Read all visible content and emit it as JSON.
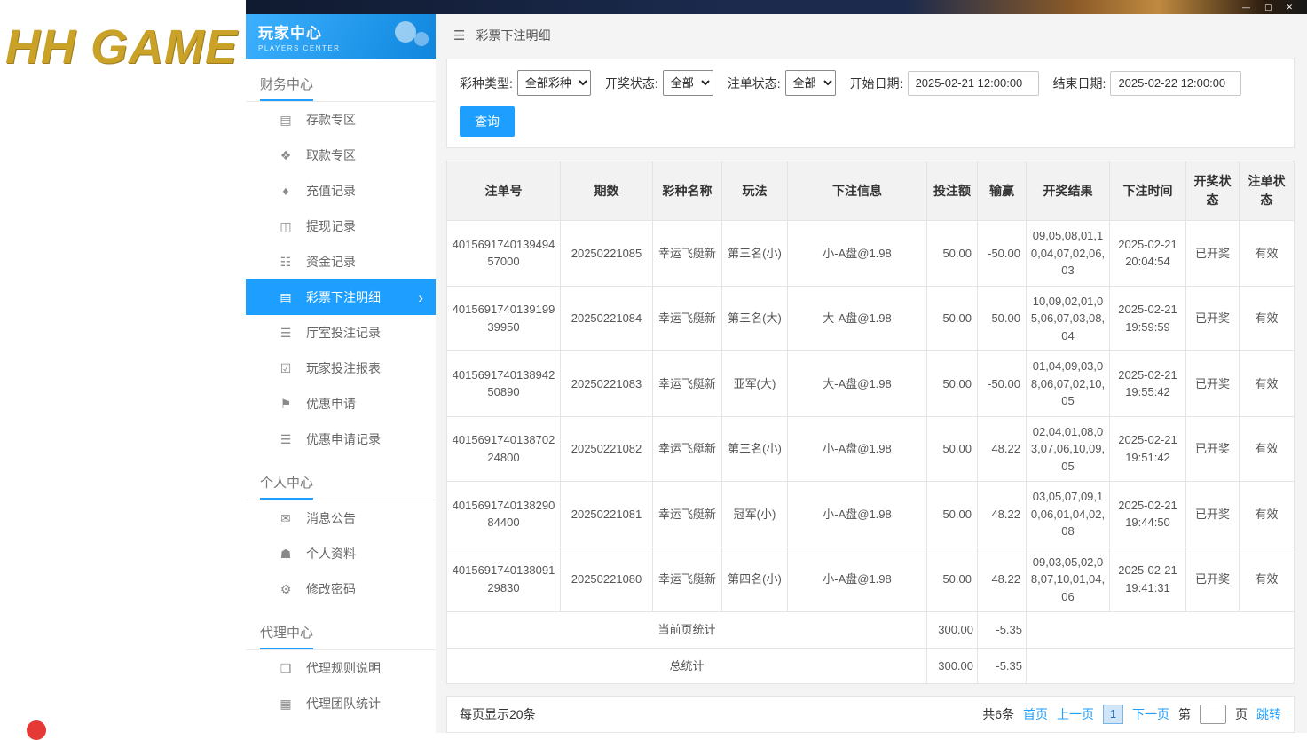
{
  "colors": {
    "accent": "#1e9fff",
    "logo_gold": "#c9a227",
    "active_item_bg": "#1e9fff",
    "titlebar_bg": "#1b2a4d"
  },
  "logo": {
    "text": "HH GAME"
  },
  "window_controls": {
    "minimize": "—",
    "maximize": "▢",
    "close": "✕"
  },
  "sidebar": {
    "title": "玩家中心",
    "subtitle": "PLAYERS CENTER",
    "chevron": "›",
    "sections": [
      {
        "title": "财务中心",
        "items": [
          {
            "id": "deposit-zone",
            "label": "存款专区",
            "icon": "deposit-icon",
            "glyph": "▤",
            "active": false
          },
          {
            "id": "withdraw-zone",
            "label": "取款专区",
            "icon": "withdraw-icon",
            "glyph": "❖",
            "active": false
          },
          {
            "id": "recharge-records",
            "label": "充值记录",
            "icon": "recharge-record-icon",
            "glyph": "♦",
            "active": false
          },
          {
            "id": "withdrawal-records",
            "label": "提现记录",
            "icon": "withdraw-record-icon",
            "glyph": "◫",
            "active": false
          },
          {
            "id": "funds-records",
            "label": "资金记录",
            "icon": "funds-record-icon",
            "glyph": "☷",
            "active": false
          },
          {
            "id": "lottery-bet-details",
            "label": "彩票下注明细",
            "icon": "lottery-detail-icon",
            "glyph": "▤",
            "active": true
          },
          {
            "id": "hall-bet-records",
            "label": "厅室投注记录",
            "icon": "hall-bet-icon",
            "glyph": "☰",
            "active": false
          },
          {
            "id": "player-bet-report",
            "label": "玩家投注报表",
            "icon": "report-icon",
            "glyph": "☑",
            "active": false
          },
          {
            "id": "promo-apply",
            "label": "优惠申请",
            "icon": "promo-icon",
            "glyph": "⚑",
            "active": false
          },
          {
            "id": "promo-apply-records",
            "label": "优惠申请记录",
            "icon": "promo-record-icon",
            "glyph": "☰",
            "active": false
          }
        ]
      },
      {
        "title": "个人中心",
        "items": [
          {
            "id": "messages",
            "label": "消息公告",
            "icon": "message-icon",
            "glyph": "✉",
            "active": false
          },
          {
            "id": "profile",
            "label": "个人资料",
            "icon": "profile-icon",
            "glyph": "☗",
            "active": false
          },
          {
            "id": "change-password",
            "label": "修改密码",
            "icon": "password-icon",
            "glyph": "⚙",
            "active": false
          }
        ]
      },
      {
        "title": "代理中心",
        "items": [
          {
            "id": "agent-rules",
            "label": "代理规则说明",
            "icon": "agent-rules-icon",
            "glyph": "❏",
            "active": false
          },
          {
            "id": "agent-team-stats",
            "label": "代理团队统计",
            "icon": "agent-stats-icon",
            "glyph": "▦",
            "active": false
          }
        ]
      }
    ]
  },
  "breadcrumb": {
    "menu_icon": "☰",
    "title": "彩票下注明细"
  },
  "filters": {
    "lottery_type_label": "彩种类型:",
    "lottery_type_value": "全部彩种",
    "draw_status_label": "开奖状态:",
    "draw_status_value": "全部",
    "bet_status_label": "注单状态:",
    "bet_status_value": "全部",
    "start_date_label": "开始日期:",
    "start_date_value": "2025-02-21 12:00:00",
    "end_date_label": "结束日期:",
    "end_date_value": "2025-02-22 12:00:00",
    "search_button": "查询"
  },
  "table": {
    "headers": [
      "注单号",
      "期数",
      "彩种名称",
      "玩法",
      "下注信息",
      "投注额",
      "输赢",
      "开奖结果",
      "下注时间",
      "开奖状态",
      "注单状态"
    ],
    "rows": [
      [
        "401569174013949457000",
        "20250221085",
        "幸运飞艇新",
        "第三名(小)",
        "小-A盘@1.98",
        "50.00",
        "-50.00",
        "09,05,08,01,10,04,07,02,06,03",
        "2025-02-21 20:04:54",
        "已开奖",
        "有效"
      ],
      [
        "401569174013919939950",
        "20250221084",
        "幸运飞艇新",
        "第三名(大)",
        "大-A盘@1.98",
        "50.00",
        "-50.00",
        "10,09,02,01,05,06,07,03,08,04",
        "2025-02-21 19:59:59",
        "已开奖",
        "有效"
      ],
      [
        "401569174013894250890",
        "20250221083",
        "幸运飞艇新",
        "亚军(大)",
        "大-A盘@1.98",
        "50.00",
        "-50.00",
        "01,04,09,03,08,06,07,02,10,05",
        "2025-02-21 19:55:42",
        "已开奖",
        "有效"
      ],
      [
        "401569174013870224800",
        "20250221082",
        "幸运飞艇新",
        "第三名(小)",
        "小-A盘@1.98",
        "50.00",
        "48.22",
        "02,04,01,08,03,07,06,10,09,05",
        "2025-02-21 19:51:42",
        "已开奖",
        "有效"
      ],
      [
        "401569174013829084400",
        "20250221081",
        "幸运飞艇新",
        "冠军(小)",
        "小-A盘@1.98",
        "50.00",
        "48.22",
        "03,05,07,09,10,06,01,04,02,08",
        "2025-02-21 19:44:50",
        "已开奖",
        "有效"
      ],
      [
        "401569174013809129830",
        "20250221080",
        "幸运飞艇新",
        "第四名(小)",
        "小-A盘@1.98",
        "50.00",
        "48.22",
        "09,03,05,02,08,07,10,01,04,06",
        "2025-02-21 19:41:31",
        "已开奖",
        "有效"
      ]
    ],
    "summary_current": {
      "label": "当前页统计",
      "bet_total": "300.00",
      "win_loss": "-5.35"
    },
    "summary_total": {
      "label": "总统计",
      "bet_total": "300.00",
      "win_loss": "-5.35"
    }
  },
  "pagination": {
    "page_size_text": "每页显示20条",
    "total_text": "共6条",
    "first_label": "首页",
    "prev_label": "上一页",
    "current_page": "1",
    "next_label": "下一页",
    "jump_prefix": "第",
    "jump_suffix": "页",
    "jump_label": "跳转"
  }
}
